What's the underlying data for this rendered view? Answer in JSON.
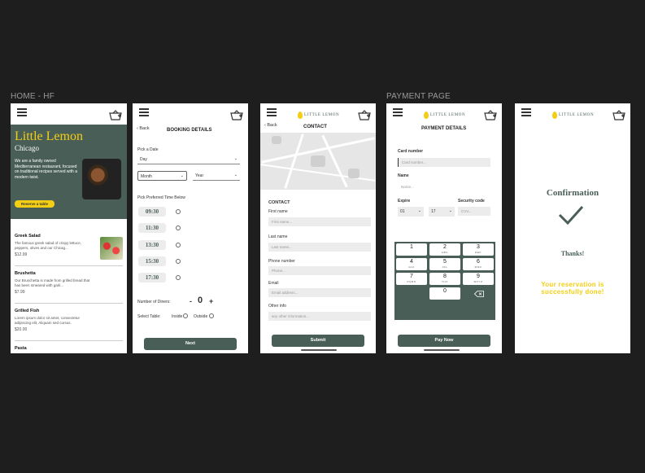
{
  "labels": {
    "home_frame": "HOME - HF",
    "payment_frame": "PAYMENT PAGE"
  },
  "brand": {
    "logo_text": "LITTLE LEMON",
    "accent": "#495e57",
    "yellow": "#f4ce14"
  },
  "home": {
    "title": "Little Lemon",
    "subtitle": "Chicago",
    "description": "We are a family owned Mediterranean restaurant, focused on traditional recipes served with a modern twist.",
    "reserve_label": "Reserve a table",
    "menu": [
      {
        "name": "Greek Salad",
        "desc": "The famous greek salad of crispy lettuce, peppers, olives and our Chicag...",
        "price": "$12.99"
      },
      {
        "name": "Brushetta",
        "desc": "Our Bruschetta is made from grilled bread that has been smeared with garli...",
        "price": "$7.99"
      },
      {
        "name": "Grilled Fish",
        "desc": "Lorem ipsum dolor sit amet, consectetur adipiscing elit, Aliquam sed cursus.",
        "price": "$20.00"
      },
      {
        "name": "Pasta",
        "desc": "",
        "price": ""
      }
    ]
  },
  "booking": {
    "back": "Back",
    "title": "BOOKING DETAILS",
    "pick_date": "Pick a Date",
    "day": "Day",
    "month": "Month",
    "year": "Year",
    "pick_time": "Pick Preferred Time Below",
    "times": [
      "09:30",
      "11:30",
      "13:30",
      "15:30",
      "17:30"
    ],
    "diners_label": "Number of Diners:",
    "diners_minus": "-",
    "diners_value": "0",
    "diners_plus": "+",
    "table_label": "Select Table:",
    "inside": "Inside",
    "outside": "Outside",
    "next": "Next"
  },
  "contact": {
    "back": "Back",
    "title": "CONTACT",
    "section": "CONTACT",
    "first_name": "First name",
    "first_ph": "First name...",
    "last_name": "Last name",
    "last_ph": "Last name...",
    "phone": "Phone number",
    "phone_ph": "Phone...",
    "email": "Email",
    "email_ph": "Email address...",
    "other": "Other info",
    "other_ph": "any other information...",
    "submit": "Submit"
  },
  "payment": {
    "title": "PAYMENT DETAILS",
    "card_label": "Card number",
    "card_ph": "Card number...",
    "name_label": "Name",
    "name_ph": "Name...",
    "expire_label": "Expire",
    "month_val": "01",
    "year_val": "17",
    "cvc_label": "Security code",
    "cvc_ph": "CVV...",
    "keys": [
      {
        "n": "1",
        "l": ""
      },
      {
        "n": "2",
        "l": "ABC"
      },
      {
        "n": "3",
        "l": "DEF"
      },
      {
        "n": "4",
        "l": "GHI"
      },
      {
        "n": "5",
        "l": "JKL"
      },
      {
        "n": "6",
        "l": "MNO"
      },
      {
        "n": "7",
        "l": "PQRS"
      },
      {
        "n": "8",
        "l": "TUV"
      },
      {
        "n": "9",
        "l": "WXYZ"
      },
      {
        "n": "0",
        "l": ""
      }
    ],
    "pay": "Pay Now"
  },
  "confirm": {
    "title": "Confirmation",
    "thanks": "Thanks!",
    "message": "Your reservation is successfully done!"
  }
}
